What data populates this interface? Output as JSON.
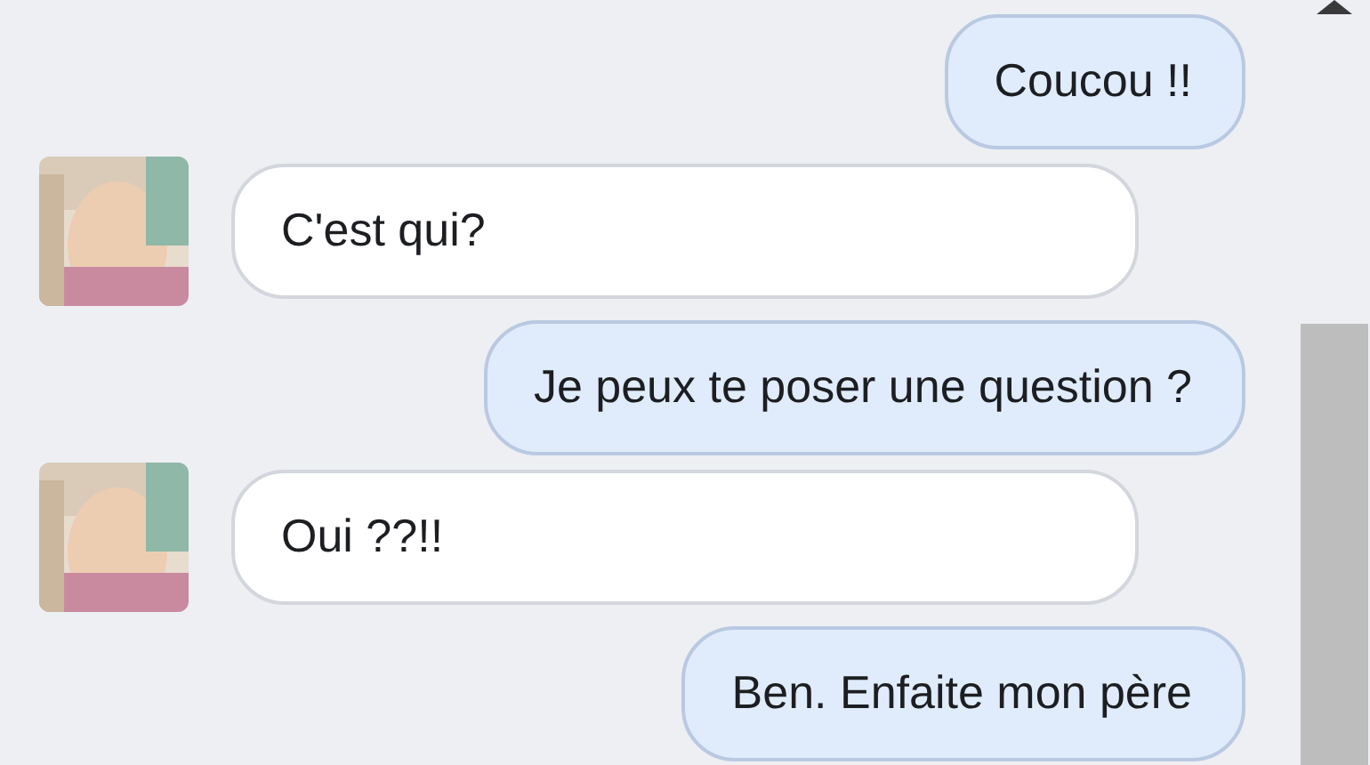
{
  "messages": [
    {
      "kind": "outgoing",
      "text": "Coucou !!"
    },
    {
      "kind": "incoming",
      "text": "C'est qui?"
    },
    {
      "kind": "outgoing",
      "text": "Je peux te poser une question ?"
    },
    {
      "kind": "incoming",
      "text": "Oui ??!!"
    },
    {
      "kind": "outgoing",
      "text": "Ben. Enfaite mon père"
    }
  ]
}
